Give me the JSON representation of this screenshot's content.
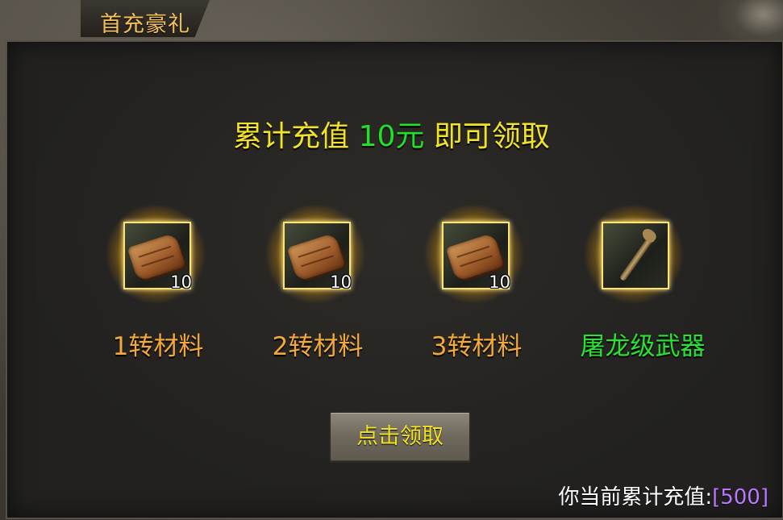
{
  "window": {
    "title": "首充豪礼"
  },
  "headline": {
    "prefix": "累计充值",
    "amount": "10元",
    "suffix": "即可领取",
    "amount_color": "#22e02a",
    "text_color": "#f2e22a"
  },
  "rewards": [
    {
      "icon": "scroll-icon",
      "count": "10",
      "label": "1转材料",
      "label_color": "#f2a83a"
    },
    {
      "icon": "scroll-icon",
      "count": "10",
      "label": "2转材料",
      "label_color": "#f2a83a"
    },
    {
      "icon": "scroll-icon",
      "count": "10",
      "label": "3转材料",
      "label_color": "#f2a83a"
    },
    {
      "icon": "staff-icon",
      "count": "",
      "label": "屠龙级武器",
      "label_color": "#2ae234"
    }
  ],
  "claim_button": {
    "label": "点击领取"
  },
  "total": {
    "prefix": "你当前累计充值:",
    "value": "[500]",
    "value_color": "#b979ff"
  }
}
